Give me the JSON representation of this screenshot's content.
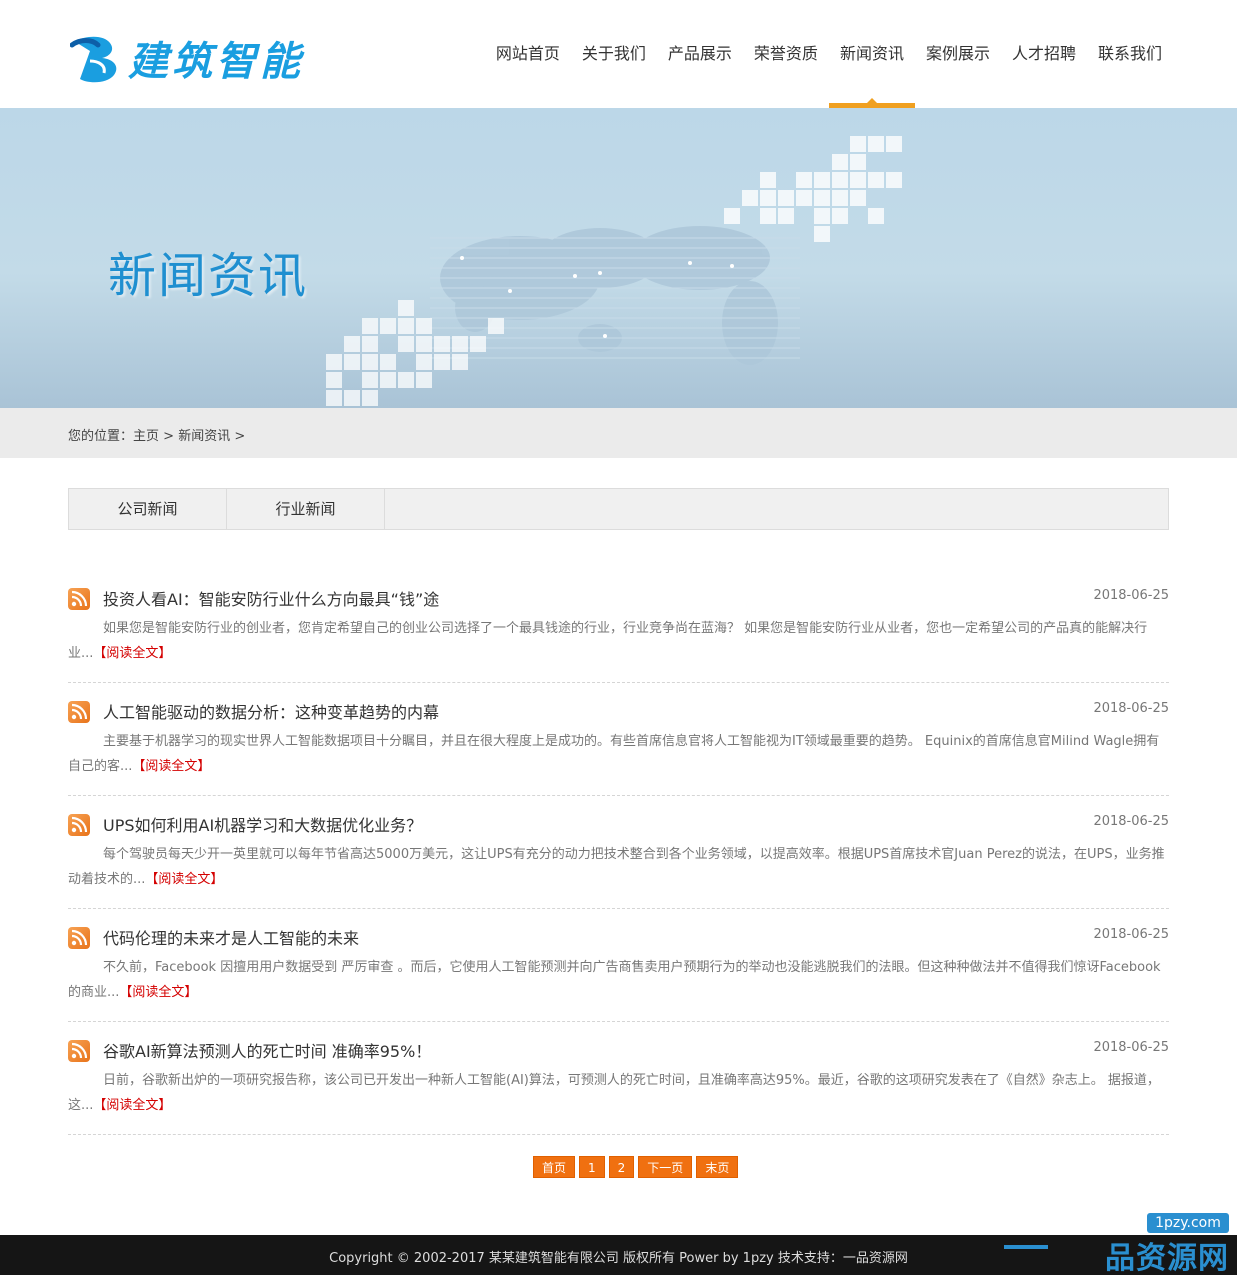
{
  "brand": {
    "name": "建筑智能",
    "color": "#1a9ee0"
  },
  "nav": {
    "items": [
      {
        "label": "网站首页"
      },
      {
        "label": "关于我们"
      },
      {
        "label": "产品展示"
      },
      {
        "label": "荣誉资质"
      },
      {
        "label": "新闻资讯"
      },
      {
        "label": "案例展示"
      },
      {
        "label": "人才招聘"
      },
      {
        "label": "联系我们"
      }
    ],
    "active_index": 4,
    "accent": "#f0a020"
  },
  "banner": {
    "title": "新闻资讯"
  },
  "breadcrumb": {
    "prefix": "您的位置：",
    "home": "主页",
    "sep1": " > ",
    "current": "新闻资讯",
    "sep2": " >"
  },
  "tabs": [
    {
      "label": "公司新闻"
    },
    {
      "label": "行业新闻"
    }
  ],
  "news": [
    {
      "title": "投资人看AI：智能安防行业什么方向最具“钱”途",
      "date": "2018-06-25",
      "summary": "如果您是智能安防行业的创业者，您肯定希望自己的创业公司选择了一个最具钱途的行业，行业竞争尚在蓝海？ 如果您是智能安防行业从业者，您也一定希望公司的产品真的能解决行业...",
      "more": "【阅读全文】"
    },
    {
      "title": "人工智能驱动的数据分析：这种变革趋势的内幕",
      "date": "2018-06-25",
      "summary": "主要基于机器学习的现实世界人工智能数据项目十分瞩目，并且在很大程度上是成功的。有些首席信息官将人工智能视为IT领域最重要的趋势。 Equinix的首席信息官Milind Wagle拥有自己的客...",
      "more": "【阅读全文】"
    },
    {
      "title": "UPS如何利用AI机器学习和大数据优化业务？",
      "date": "2018-06-25",
      "summary": "每个驾驶员每天少开一英里就可以每年节省高达5000万美元，这让UPS有充分的动力把技术整合到各个业务领域，以提高效率。根据UPS首席技术官Juan Perez的说法，在UPS，业务推动着技术的...",
      "more": "【阅读全文】"
    },
    {
      "title": "代码伦理的未来才是人工智能的未来",
      "date": "2018-06-25",
      "summary": "不久前，Facebook 因擅用用户数据受到 严厉审查 。而后，它使用人工智能预测并向广告商售卖用户预期行为的举动也没能逃脱我们的法眼。但这种种做法并不值得我们惊讶Facebook 的商业...",
      "more": "【阅读全文】"
    },
    {
      "title": "谷歌AI新算法预测人的死亡时间 准确率95%！",
      "date": "2018-06-25",
      "summary": "日前，谷歌新出炉的一项研究报告称，该公司已开发出一种新人工智能(AI)算法，可预测人的死亡时间，且准确率高达95%。最近，谷歌的这项研究发表在了《自然》杂志上。 据报道，这...",
      "more": "【阅读全文】"
    }
  ],
  "pager": [
    {
      "label": "首页"
    },
    {
      "label": "1"
    },
    {
      "label": "2"
    },
    {
      "label": "下一页"
    },
    {
      "label": "末页"
    }
  ],
  "footer": {
    "copyright": "Copyright © 2002-2017 某某建筑智能有限公司 版权所有 Power by 1pzy   技术支持：一品资源网"
  },
  "watermark": {
    "url": "1pzy.com",
    "text": "品资源网"
  }
}
